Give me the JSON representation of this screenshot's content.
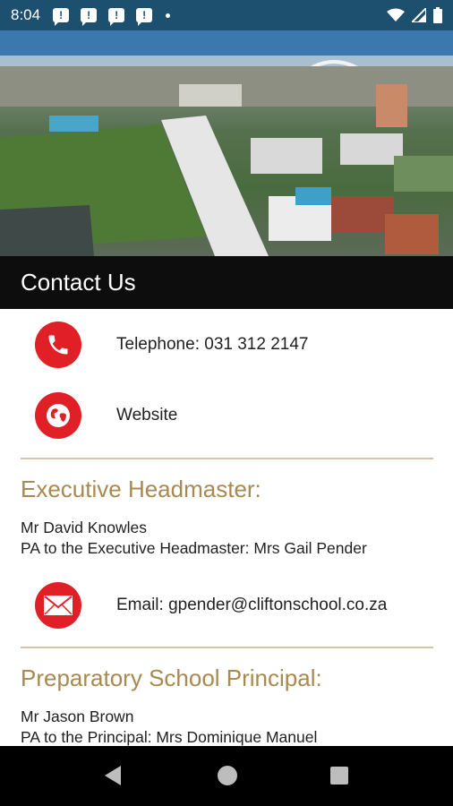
{
  "status_bar": {
    "time": "8:04",
    "notification_icons": [
      "alert-message-icon",
      "alert-message-icon",
      "alert-message-icon",
      "alert-message-icon"
    ],
    "right_icons": [
      "wifi-icon",
      "signal-icon",
      "battery-icon"
    ]
  },
  "hero": {
    "description_icon": "school-aerial-photo"
  },
  "header": {
    "title": "Contact Us"
  },
  "contacts": {
    "telephone": "Telephone:  031 312 2147",
    "website": "Website"
  },
  "executive": {
    "title": "Executive Headmaster:",
    "name": "Mr David Knowles",
    "pa": "PA to the Executive Headmaster:  Mrs Gail Pender",
    "email": "Email: gpender@cliftonschool.co.za"
  },
  "preparatory": {
    "title": "Preparatory School Principal:",
    "name": "Mr Jason Brown",
    "pa": "PA to the Principal:  Mrs Dominique Manuel"
  },
  "colors": {
    "accent_red": "#e01f26",
    "gold": "#a8894f",
    "header_bg": "#0d0d0d",
    "status_bg": "#1d4f6e"
  }
}
